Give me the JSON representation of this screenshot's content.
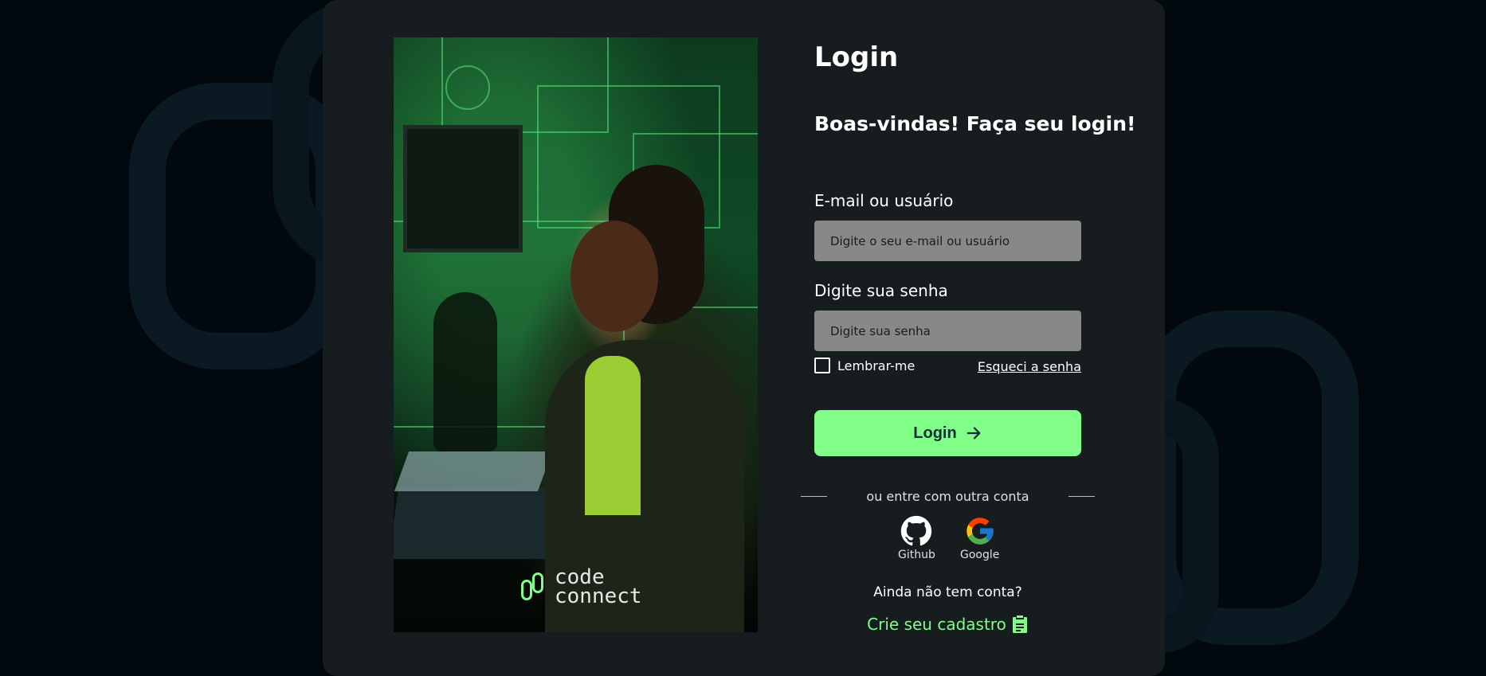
{
  "colors": {
    "page_background": "#01080e",
    "card_background": "#171d1f",
    "accent": "#81fe88",
    "input_background": "#888888",
    "text": "#ffffff"
  },
  "hero": {
    "brand_line1": "code",
    "brand_line2": "connect",
    "brand_icon": "chain-link-icon"
  },
  "login": {
    "title": "Login",
    "subtitle": "Boas-vindas! Faça seu login!",
    "email_label": "E-mail ou usuário",
    "email_placeholder": "Digite o seu e-mail ou usuário",
    "password_label": "Digite sua senha",
    "password_placeholder": "Digite sua senha",
    "remember_label": "Lembrar-me",
    "forgot_link": "Esqueci a senha",
    "submit_label": "Login",
    "submit_icon": "arrow-right-icon"
  },
  "social": {
    "divider_text": "ou entre com outra conta",
    "providers": [
      {
        "label": "Github",
        "icon": "github-icon"
      },
      {
        "label": "Google",
        "icon": "google-icon"
      }
    ]
  },
  "signup": {
    "prompt": "Ainda não tem conta?",
    "link": "Crie seu cadastro",
    "icon": "clipboard-icon"
  }
}
